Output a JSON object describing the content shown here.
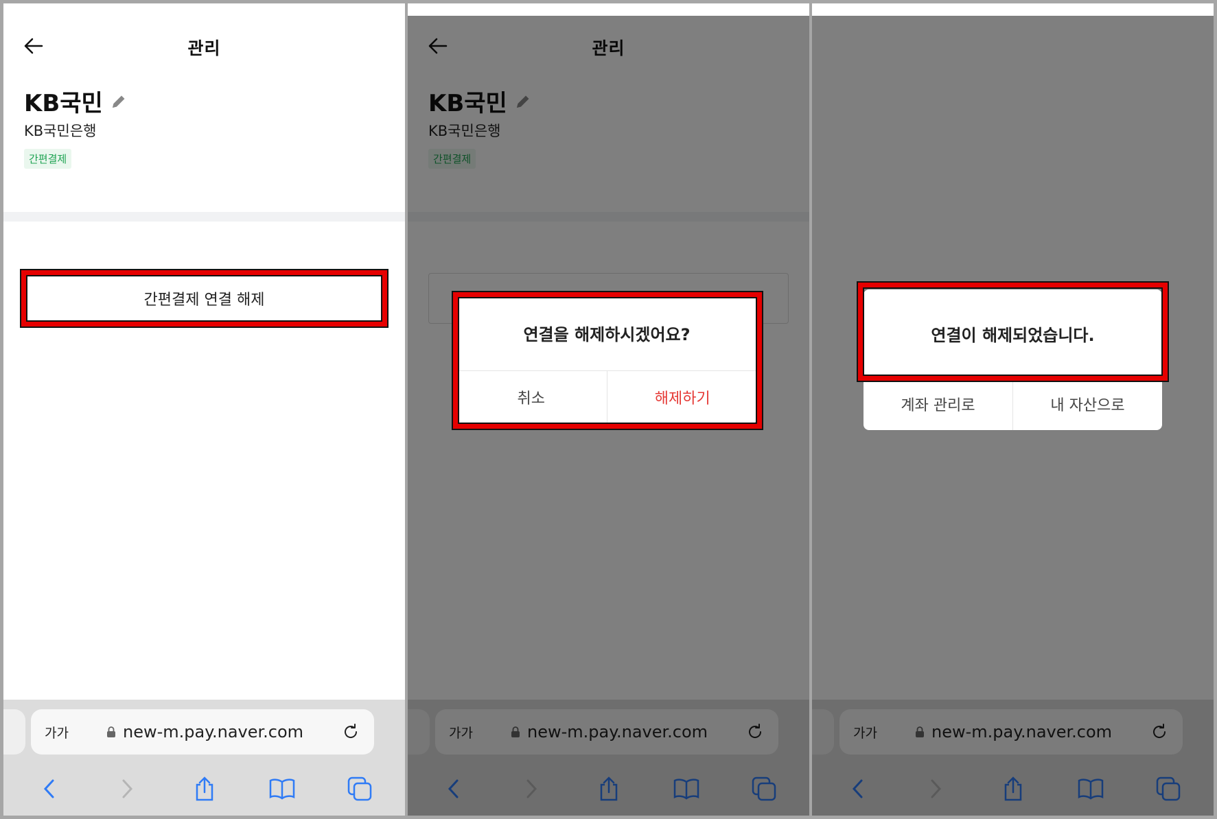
{
  "panels": [
    {
      "nav_title": "관리",
      "bank_name": "KB국민",
      "bank_full_name": "KB국민은행",
      "tag": "간편결제",
      "unlink_button": "간편결제 연결 해제"
    },
    {
      "nav_title": "관리",
      "bank_name": "KB국민",
      "bank_full_name": "KB국민은행",
      "tag": "간편결제",
      "dialog": {
        "message": "연결을 해제하시겠어요?",
        "cancel": "취소",
        "confirm": "해제하기"
      }
    },
    {
      "dialog": {
        "message": "연결이 해제되었습니다.",
        "to_accounts": "계좌 관리로",
        "to_assets": "내 자산으로"
      }
    }
  ],
  "browser": {
    "text_size": "가가",
    "url": "new-m.pay.naver.com"
  },
  "colors": {
    "highlight": "#e60000",
    "confirm_red": "#e53935",
    "tag_green": "#1fa352",
    "toolbar_blue": "#2f7bf6"
  }
}
